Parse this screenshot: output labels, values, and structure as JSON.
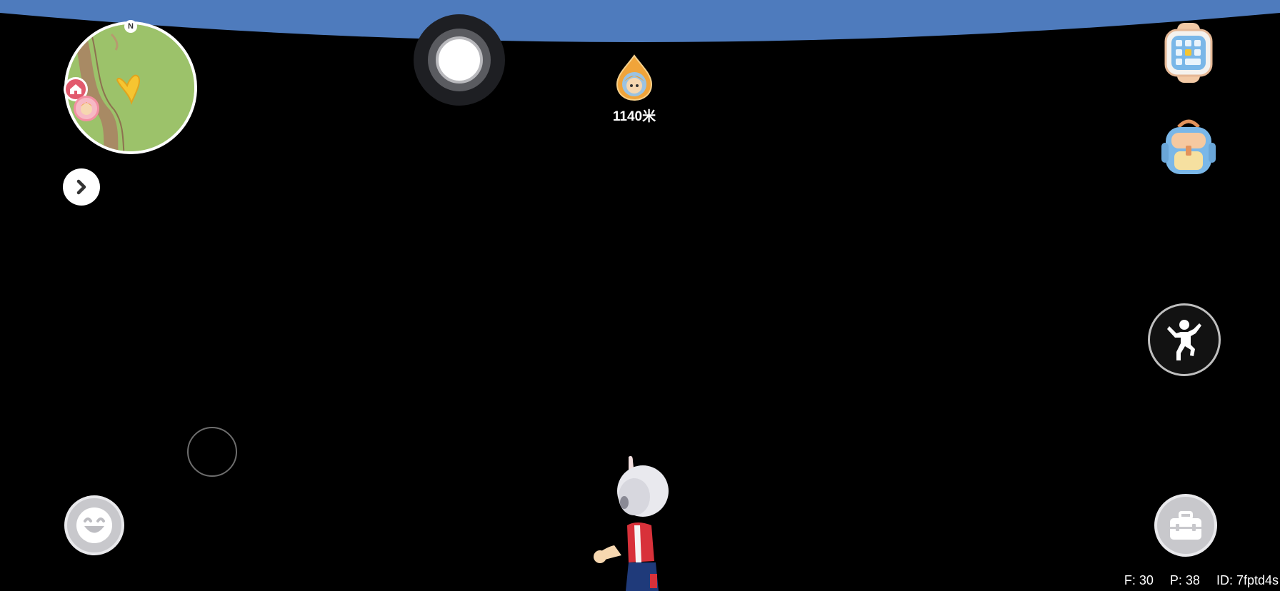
{
  "hud": {
    "compass_label": "N",
    "distance": "1140米"
  },
  "debug": {
    "fps": "F: 30",
    "ping": "P: 38",
    "id": "ID: 7fptd4s"
  },
  "icons": {
    "expand": "chevron-right-icon",
    "camera": "camera-shutter-icon",
    "watch": "smartwatch-icon",
    "bag": "backpack-icon",
    "jump": "jump-pose-icon",
    "toolbox": "toolbox-icon",
    "emote": "smile-emote-icon"
  },
  "colors": {
    "sky": "#4e7bbd",
    "background": "#000000",
    "map_grass": "#9cc26a",
    "map_path": "#a88a64",
    "map_marker": "#f6c531",
    "home_marker": "#e25a6e",
    "target_marker": "#f0a43a"
  }
}
